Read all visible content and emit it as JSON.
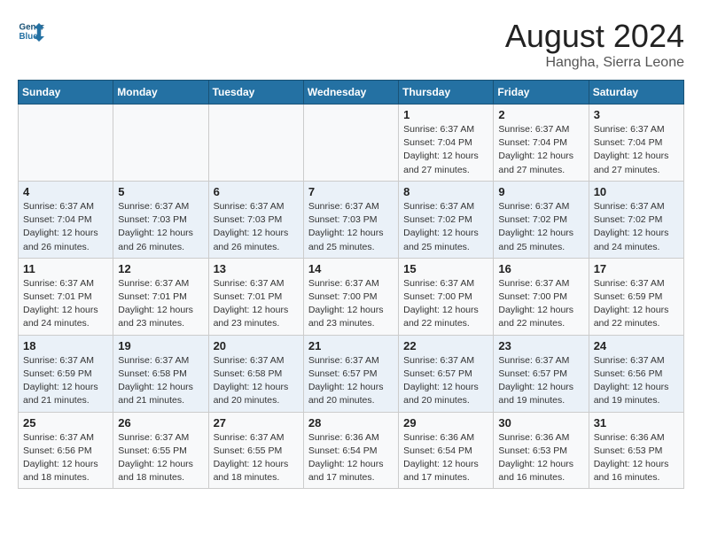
{
  "header": {
    "logo_line1": "General",
    "logo_line2": "Blue",
    "main_title": "August 2024",
    "subtitle": "Hangha, Sierra Leone"
  },
  "weekdays": [
    "Sunday",
    "Monday",
    "Tuesday",
    "Wednesday",
    "Thursday",
    "Friday",
    "Saturday"
  ],
  "weeks": [
    [
      {
        "day": "",
        "info": ""
      },
      {
        "day": "",
        "info": ""
      },
      {
        "day": "",
        "info": ""
      },
      {
        "day": "",
        "info": ""
      },
      {
        "day": "1",
        "info": "Sunrise: 6:37 AM\nSunset: 7:04 PM\nDaylight: 12 hours\nand 27 minutes."
      },
      {
        "day": "2",
        "info": "Sunrise: 6:37 AM\nSunset: 7:04 PM\nDaylight: 12 hours\nand 27 minutes."
      },
      {
        "day": "3",
        "info": "Sunrise: 6:37 AM\nSunset: 7:04 PM\nDaylight: 12 hours\nand 27 minutes."
      }
    ],
    [
      {
        "day": "4",
        "info": "Sunrise: 6:37 AM\nSunset: 7:04 PM\nDaylight: 12 hours\nand 26 minutes."
      },
      {
        "day": "5",
        "info": "Sunrise: 6:37 AM\nSunset: 7:03 PM\nDaylight: 12 hours\nand 26 minutes."
      },
      {
        "day": "6",
        "info": "Sunrise: 6:37 AM\nSunset: 7:03 PM\nDaylight: 12 hours\nand 26 minutes."
      },
      {
        "day": "7",
        "info": "Sunrise: 6:37 AM\nSunset: 7:03 PM\nDaylight: 12 hours\nand 25 minutes."
      },
      {
        "day": "8",
        "info": "Sunrise: 6:37 AM\nSunset: 7:02 PM\nDaylight: 12 hours\nand 25 minutes."
      },
      {
        "day": "9",
        "info": "Sunrise: 6:37 AM\nSunset: 7:02 PM\nDaylight: 12 hours\nand 25 minutes."
      },
      {
        "day": "10",
        "info": "Sunrise: 6:37 AM\nSunset: 7:02 PM\nDaylight: 12 hours\nand 24 minutes."
      }
    ],
    [
      {
        "day": "11",
        "info": "Sunrise: 6:37 AM\nSunset: 7:01 PM\nDaylight: 12 hours\nand 24 minutes."
      },
      {
        "day": "12",
        "info": "Sunrise: 6:37 AM\nSunset: 7:01 PM\nDaylight: 12 hours\nand 23 minutes."
      },
      {
        "day": "13",
        "info": "Sunrise: 6:37 AM\nSunset: 7:01 PM\nDaylight: 12 hours\nand 23 minutes."
      },
      {
        "day": "14",
        "info": "Sunrise: 6:37 AM\nSunset: 7:00 PM\nDaylight: 12 hours\nand 23 minutes."
      },
      {
        "day": "15",
        "info": "Sunrise: 6:37 AM\nSunset: 7:00 PM\nDaylight: 12 hours\nand 22 minutes."
      },
      {
        "day": "16",
        "info": "Sunrise: 6:37 AM\nSunset: 7:00 PM\nDaylight: 12 hours\nand 22 minutes."
      },
      {
        "day": "17",
        "info": "Sunrise: 6:37 AM\nSunset: 6:59 PM\nDaylight: 12 hours\nand 22 minutes."
      }
    ],
    [
      {
        "day": "18",
        "info": "Sunrise: 6:37 AM\nSunset: 6:59 PM\nDaylight: 12 hours\nand 21 minutes."
      },
      {
        "day": "19",
        "info": "Sunrise: 6:37 AM\nSunset: 6:58 PM\nDaylight: 12 hours\nand 21 minutes."
      },
      {
        "day": "20",
        "info": "Sunrise: 6:37 AM\nSunset: 6:58 PM\nDaylight: 12 hours\nand 20 minutes."
      },
      {
        "day": "21",
        "info": "Sunrise: 6:37 AM\nSunset: 6:57 PM\nDaylight: 12 hours\nand 20 minutes."
      },
      {
        "day": "22",
        "info": "Sunrise: 6:37 AM\nSunset: 6:57 PM\nDaylight: 12 hours\nand 20 minutes."
      },
      {
        "day": "23",
        "info": "Sunrise: 6:37 AM\nSunset: 6:57 PM\nDaylight: 12 hours\nand 19 minutes."
      },
      {
        "day": "24",
        "info": "Sunrise: 6:37 AM\nSunset: 6:56 PM\nDaylight: 12 hours\nand 19 minutes."
      }
    ],
    [
      {
        "day": "25",
        "info": "Sunrise: 6:37 AM\nSunset: 6:56 PM\nDaylight: 12 hours\nand 18 minutes."
      },
      {
        "day": "26",
        "info": "Sunrise: 6:37 AM\nSunset: 6:55 PM\nDaylight: 12 hours\nand 18 minutes."
      },
      {
        "day": "27",
        "info": "Sunrise: 6:37 AM\nSunset: 6:55 PM\nDaylight: 12 hours\nand 18 minutes."
      },
      {
        "day": "28",
        "info": "Sunrise: 6:36 AM\nSunset: 6:54 PM\nDaylight: 12 hours\nand 17 minutes."
      },
      {
        "day": "29",
        "info": "Sunrise: 6:36 AM\nSunset: 6:54 PM\nDaylight: 12 hours\nand 17 minutes."
      },
      {
        "day": "30",
        "info": "Sunrise: 6:36 AM\nSunset: 6:53 PM\nDaylight: 12 hours\nand 16 minutes."
      },
      {
        "day": "31",
        "info": "Sunrise: 6:36 AM\nSunset: 6:53 PM\nDaylight: 12 hours\nand 16 minutes."
      }
    ]
  ]
}
